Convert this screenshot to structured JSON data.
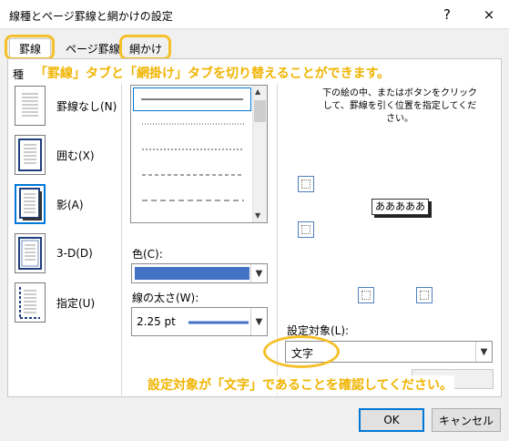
{
  "window": {
    "title": "線種とページ罫線と網かけの設定",
    "help": "?",
    "close": "×"
  },
  "tabs": [
    {
      "label": "罫線"
    },
    {
      "label": "ページ罫線"
    },
    {
      "label": "網かけ"
    }
  ],
  "annotations": {
    "top": "「罫線」タブと「網掛け」タブを切り替えることができます。",
    "bottom": "設定対象が「文字」であることを確認してください。"
  },
  "settings": {
    "heading": "種",
    "items": [
      {
        "label": "罫線なし(N)"
      },
      {
        "label": "囲む(X)"
      },
      {
        "label": "影(A)"
      },
      {
        "label": "3-D(D)"
      },
      {
        "label": "指定(U)"
      }
    ]
  },
  "color": {
    "label": "色(C):",
    "value_color": "#4472c4"
  },
  "width": {
    "label": "線の太さ(W):",
    "value": "2.25 pt"
  },
  "preview": {
    "instruction": "下の絵の中、またはボタンをクリックして、罫線を引く位置を指定してください。",
    "sample_text": "あああああ"
  },
  "apply_to": {
    "label": "設定対象(L):",
    "value": "文字"
  },
  "buttons": {
    "ok": "OK",
    "cancel": "キャンセル"
  },
  "colors": {
    "accent": "#0078d7",
    "highlight": "#f5c02a",
    "annotation": "#f0b400"
  }
}
